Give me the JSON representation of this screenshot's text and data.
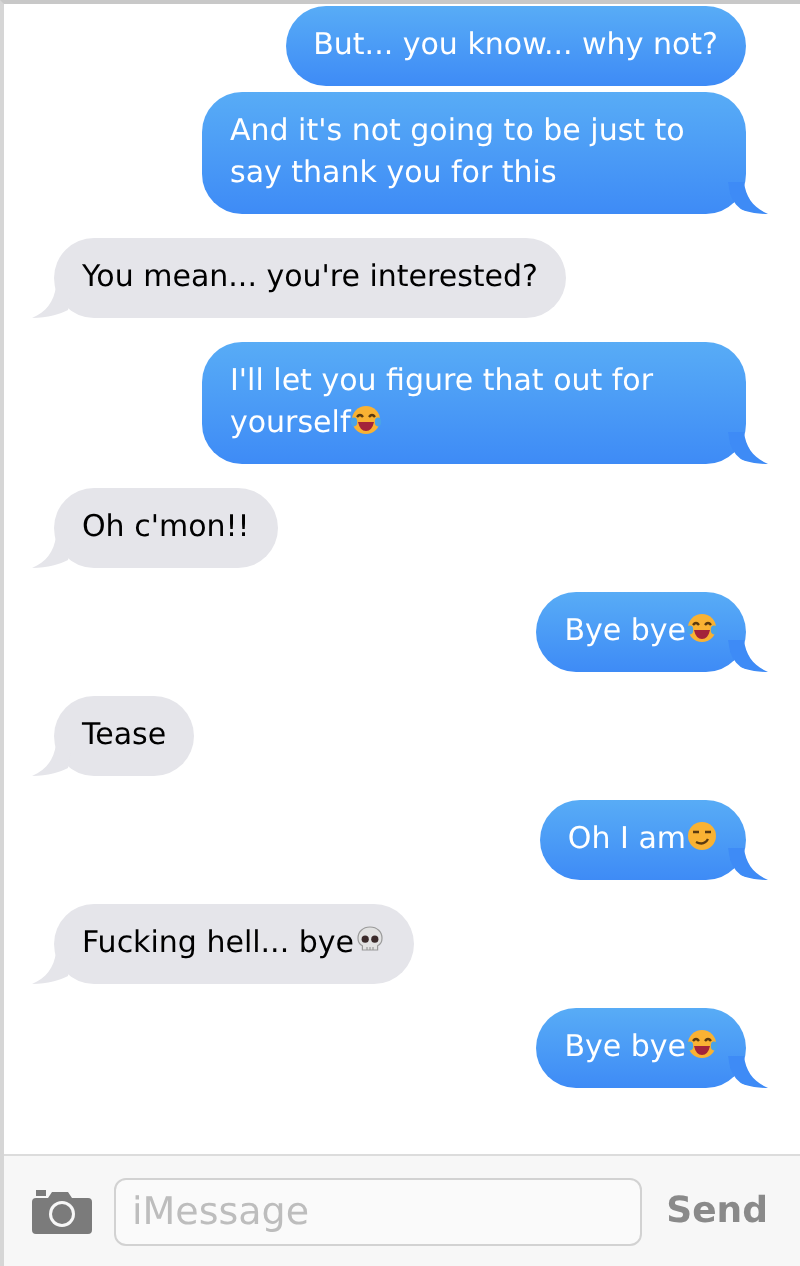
{
  "messages": [
    {
      "kind": "sent",
      "text": "But... you know... why not?",
      "tail": false
    },
    {
      "kind": "sent",
      "text": "And it's not going to be just to say thank you for this",
      "tail": true
    },
    {
      "kind": "received",
      "text": "You mean... you're interested?",
      "tail": true
    },
    {
      "kind": "sent",
      "text": "I'll let you figure that out for yourself",
      "emoji": {
        "kind": "laughing"
      },
      "tail": true
    },
    {
      "kind": "received",
      "text": "Oh c'mon!!",
      "tail": true
    },
    {
      "kind": "sent",
      "text": "Bye bye",
      "emoji": {
        "kind": "laughing"
      },
      "tail": true
    },
    {
      "kind": "received",
      "text": "Tease",
      "tail": true
    },
    {
      "kind": "sent",
      "text": "Oh I am",
      "emoji": {
        "kind": "smirk"
      },
      "tail": true
    },
    {
      "kind": "received",
      "text": "Fucking hell... bye",
      "emoji": {
        "kind": "skull"
      },
      "tail": true
    },
    {
      "kind": "sent",
      "text": "Bye bye",
      "emoji": {
        "kind": "laughing"
      },
      "tail": true
    }
  ],
  "composer": {
    "placeholder": "iMessage",
    "send": "Send"
  }
}
